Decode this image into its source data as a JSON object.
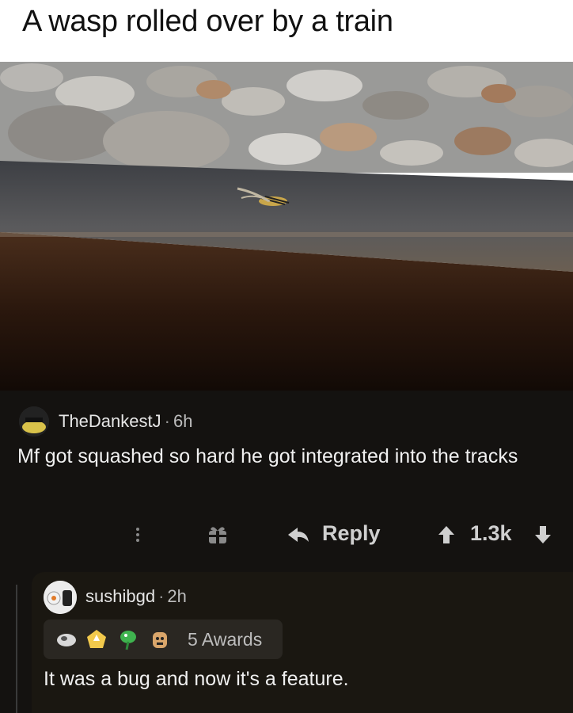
{
  "meme": {
    "title": "A wasp rolled over by a train"
  },
  "comment": {
    "username": "TheDankestJ",
    "separator": "·",
    "age": "6h",
    "body": "Mf got squashed so hard he got integrated into the tracks",
    "actions": {
      "reply_label": "Reply",
      "score": "1.3k"
    },
    "icons": [
      "more-vert-icon",
      "gift-icon",
      "reply-arrow-icon",
      "upvote-icon",
      "downvote-icon"
    ]
  },
  "reply": {
    "username": "sushibgd",
    "separator": "·",
    "age": "2h",
    "awards_label": "5 Awards",
    "body": "It was a bug and now it's a feature."
  },
  "colors": {
    "dark_bg": "#141210",
    "reply_bg": "#1a1711",
    "text": "#f0f0f0",
    "muted": "#bdbdbd"
  }
}
